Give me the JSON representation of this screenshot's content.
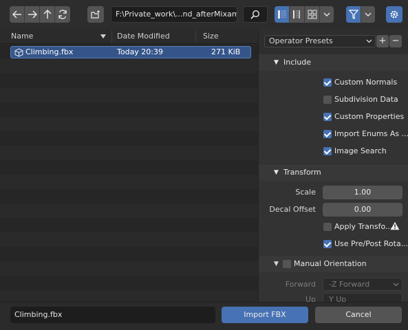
{
  "toolbar": {
    "nav_buttons": [
      {
        "icon": "arrow-left-icon"
      },
      {
        "icon": "arrow-right-icon"
      },
      {
        "icon": "arrow-up-icon"
      },
      {
        "icon": "refresh-icon"
      }
    ],
    "new_folder_icon": "new-folder-icon",
    "path": "F:\\Private_work\\...nd_afterMixamo\\",
    "search_icon": "search-icon",
    "display_modes": [
      "vertical-list-icon",
      "horizontal-list-icon",
      "thumbnails-icon"
    ],
    "active_display_mode": 0,
    "filter_active": true,
    "accent_color": "#4772b3"
  },
  "file_list": {
    "columns": [
      "Name",
      "Date Modified",
      "Size"
    ],
    "files": [
      {
        "name": "Climbing.fbx",
        "date": "Today 20:39",
        "size": "271 KiB",
        "selected": true
      }
    ]
  },
  "sidebar": {
    "operator_presets": "Operator Presets",
    "add_label": "+",
    "remove_label": "−",
    "include": {
      "title": "Include",
      "options": [
        {
          "label": "Custom Normals",
          "checked": true
        },
        {
          "label": "Subdivision Data",
          "checked": false
        },
        {
          "label": "Custom Properties",
          "checked": true
        },
        {
          "label": "Import Enums As ...",
          "checked": true
        },
        {
          "label": "Image Search",
          "checked": true
        }
      ]
    },
    "transform": {
      "title": "Transform",
      "scale_label": "Scale",
      "scale_value": "1.00",
      "decal_label": "Decal Offset",
      "decal_value": "0.00",
      "apply_transform": {
        "label": "Apply Transfo...",
        "checked": false,
        "warning_icon": "warning-icon"
      },
      "use_prepost": {
        "label": "Use Pre/Post Rota...",
        "checked": true
      }
    },
    "manual_orientation": {
      "title": "Manual Orientation",
      "checked": false,
      "forward_label": "Forward",
      "forward_value": "-Z Forward",
      "up_label": "Up",
      "up_value": "Y Up"
    }
  },
  "footer": {
    "filename": "Climbing.fbx",
    "import_label": "Import FBX",
    "cancel_label": "Cancel"
  }
}
